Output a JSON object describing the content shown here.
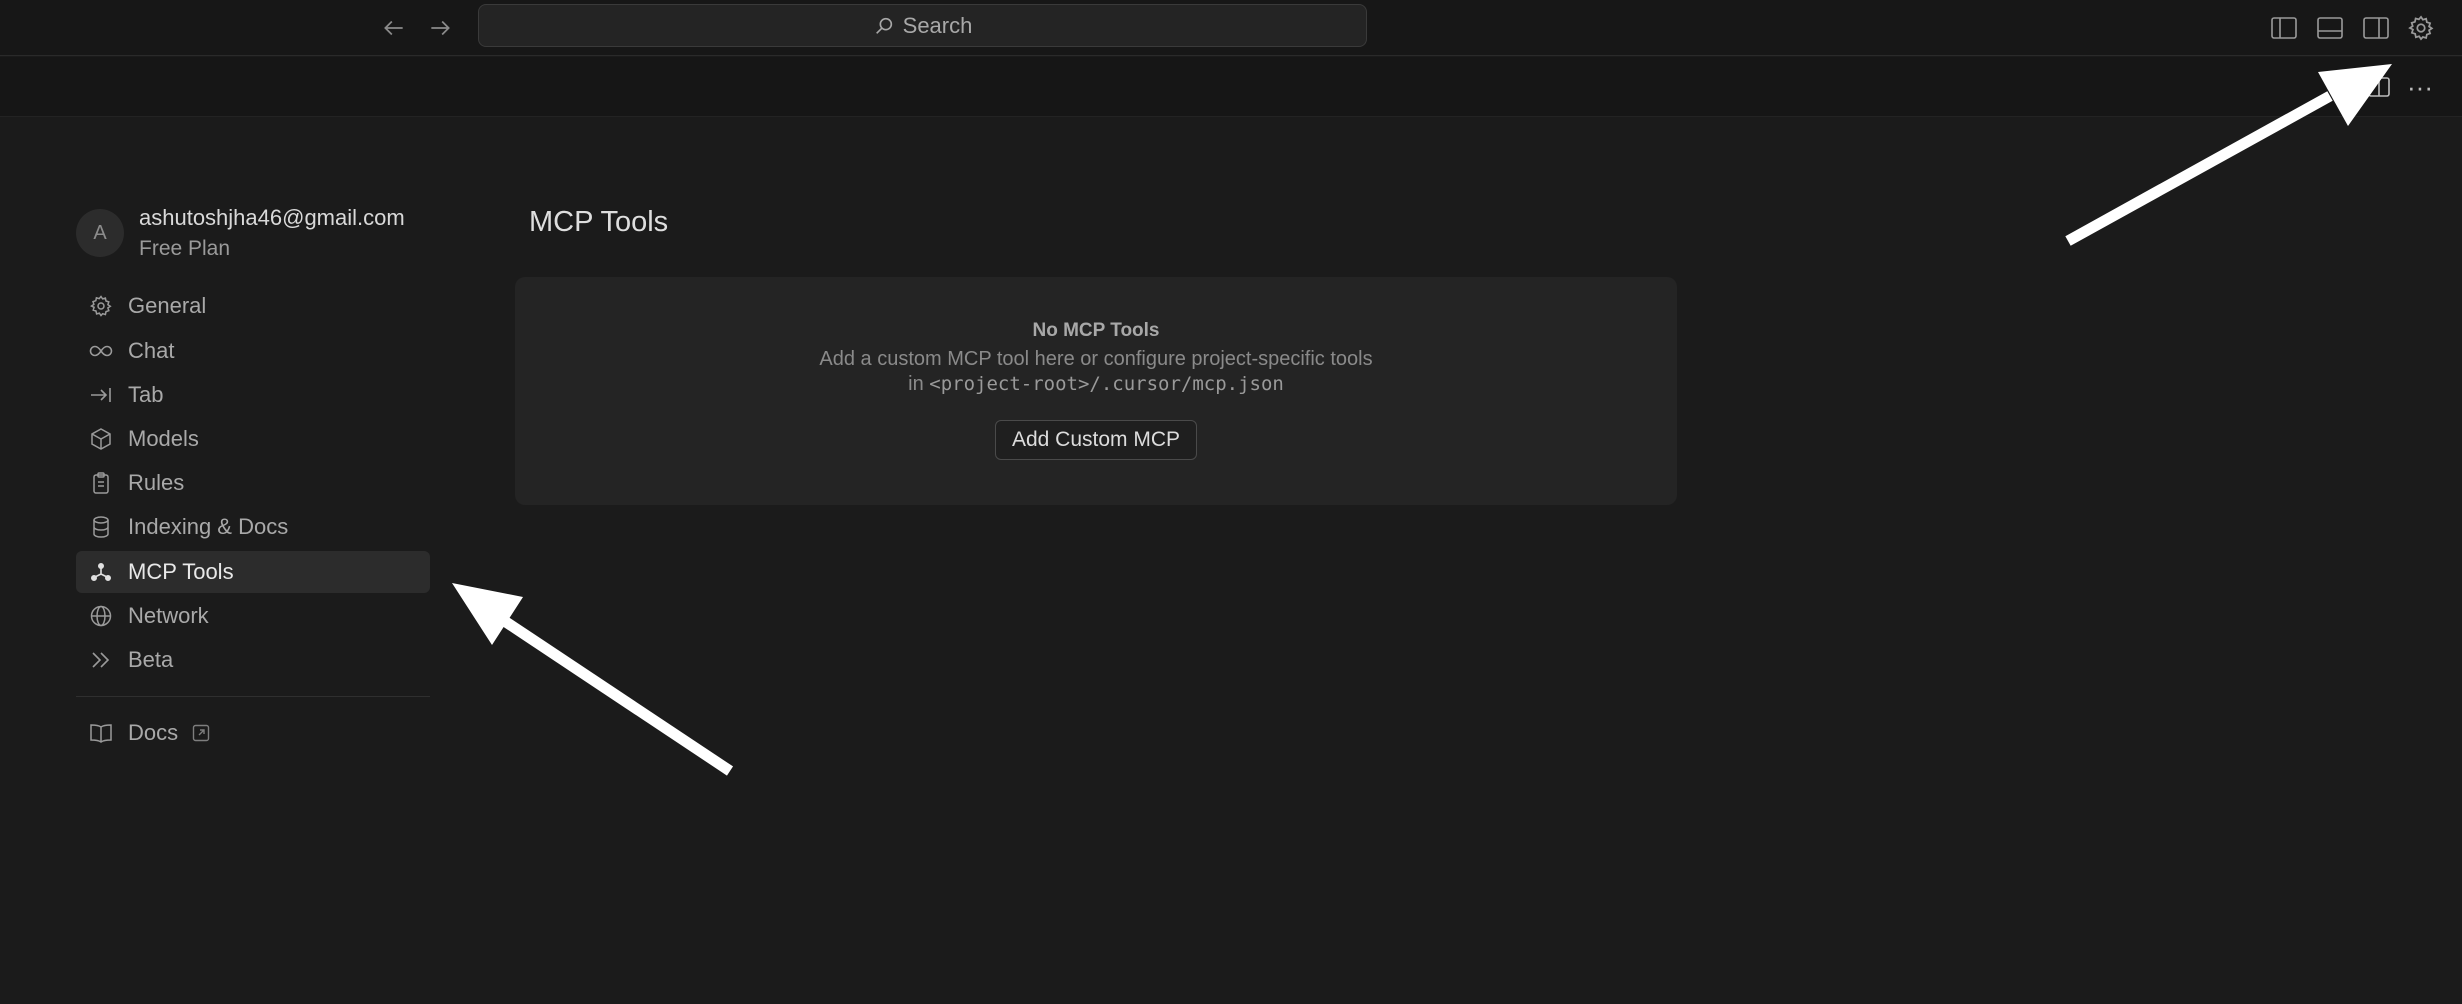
{
  "titlebar": {
    "back_icon": "arrow-left-icon",
    "forward_icon": "arrow-right-icon",
    "search_placeholder": "Search",
    "layout_icons": [
      "toggle-primary-sidebar-icon",
      "toggle-panel-icon",
      "toggle-secondary-sidebar-icon",
      "settings-gear-icon"
    ]
  },
  "toolbar": {
    "more_label": "···"
  },
  "user": {
    "avatar_initial": "A",
    "email": "ashutoshjha46@gmail.com",
    "plan": "Free Plan"
  },
  "sidebar": {
    "items": [
      {
        "label": "General",
        "icon": "gear-icon"
      },
      {
        "label": "Chat",
        "icon": "infinity-icon"
      },
      {
        "label": "Tab",
        "icon": "tab-arrow-icon"
      },
      {
        "label": "Models",
        "icon": "cube-icon"
      },
      {
        "label": "Rules",
        "icon": "clipboard-icon"
      },
      {
        "label": "Indexing & Docs",
        "icon": "database-icon"
      },
      {
        "label": "MCP Tools",
        "icon": "mcp-nodes-icon",
        "active": true
      },
      {
        "label": "Network",
        "icon": "globe-icon"
      },
      {
        "label": "Beta",
        "icon": "double-chevron-icon"
      }
    ],
    "docs": {
      "label": "Docs",
      "icon": "book-icon",
      "external_icon": "external-link-icon"
    }
  },
  "main": {
    "title": "MCP Tools",
    "empty": {
      "title": "No MCP Tools",
      "desc_line1": "Add a custom MCP tool here or configure project-specific tools",
      "desc_in": "in ",
      "desc_path": "<project-root>/.cursor/mcp.json",
      "button": "Add Custom MCP"
    }
  },
  "colors": {
    "background": "#1b1b1b",
    "panel": "#242424",
    "active_item": "#2c2c2c",
    "annotation_arrow": "#ffffff"
  }
}
